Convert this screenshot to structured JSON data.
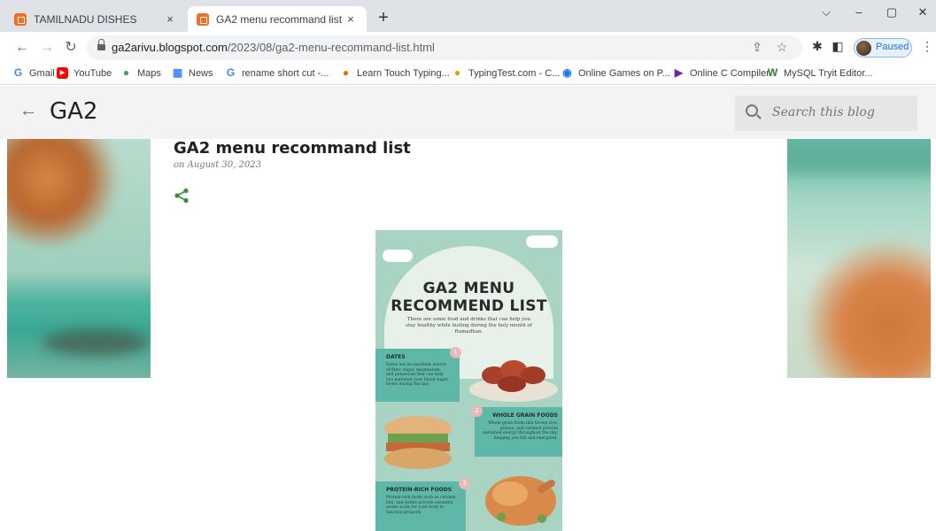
{
  "tabs": [
    {
      "title": "TAMILNADU DISHES",
      "close": "×"
    },
    {
      "title": "GA2 menu recommand list",
      "close": "×"
    }
  ],
  "new_tab_label": "+",
  "window_controls": {
    "chevron": "⌵",
    "minimize": "–",
    "restore": "▢",
    "close": "✕"
  },
  "toolbar": {
    "back": "←",
    "forward": "→",
    "reload": "↻",
    "url_host": "ga2arivu.blogspot.com",
    "url_path": "/2023/08/ga2-menu-recommand-list.html",
    "profile_status": "Paused",
    "menu": "⋮"
  },
  "bookmarks": [
    {
      "label": "Gmail",
      "icon": "G",
      "color": "#4285f4"
    },
    {
      "label": "YouTube",
      "icon": "▶",
      "color": "#ff0000"
    },
    {
      "label": "Maps",
      "icon": "●",
      "color": "#34a853"
    },
    {
      "label": "News",
      "icon": "▦",
      "color": "#4285f4"
    },
    {
      "label": "rename short cut -...",
      "icon": "G",
      "color": "#4285f4"
    },
    {
      "label": "Learn Touch Typing...",
      "icon": "●",
      "color": "#e37400"
    },
    {
      "label": "TypingTest.com - C...",
      "icon": "●",
      "color": "#f29900"
    },
    {
      "label": "Online Games on P...",
      "icon": "◉",
      "color": "#1a73e8"
    },
    {
      "label": "Online C Compiler",
      "icon": "▶",
      "color": "#7b1fa2"
    },
    {
      "label": "MySQL Tryit Editor...",
      "icon": "W",
      "color": "#2e7d32"
    }
  ],
  "blog": {
    "back": "←",
    "title": "GA2",
    "search_placeholder": "Search this blog"
  },
  "post": {
    "title": "GA2 menu recommand list",
    "date": "on August 30, 2023"
  },
  "infographic": {
    "title_line1": "GA2 MENU",
    "title_line2": "RECOMMEND LIST",
    "subtitle": "There are some food and drinks that can help you stay healthy while fasting during the holy month of Ramadhan.",
    "sections": [
      {
        "number": "1",
        "heading": "DATES",
        "text": "Dates are an excellent source of fiber, sugar, magnesium, and potassium that can help you maintain your blood sugar levels during the day."
      },
      {
        "number": "2",
        "heading": "WHOLE GRAIN FOODS",
        "text": "Whole grain foods like brown rice, quinoa, and oatmeal provide sustained energy throughout the day, keeping you full and energized."
      },
      {
        "number": "3",
        "heading": "PROTEIN-RICH FOODS",
        "text": "Protein-rich foods such as chicken, fish, and lentils provide essential amino acids for your body to function properly."
      }
    ]
  },
  "colors": {
    "accent_green": "#3d8b3d",
    "infographic_bg": "#a9d3c2",
    "card_teal": "#5fb8a7"
  }
}
